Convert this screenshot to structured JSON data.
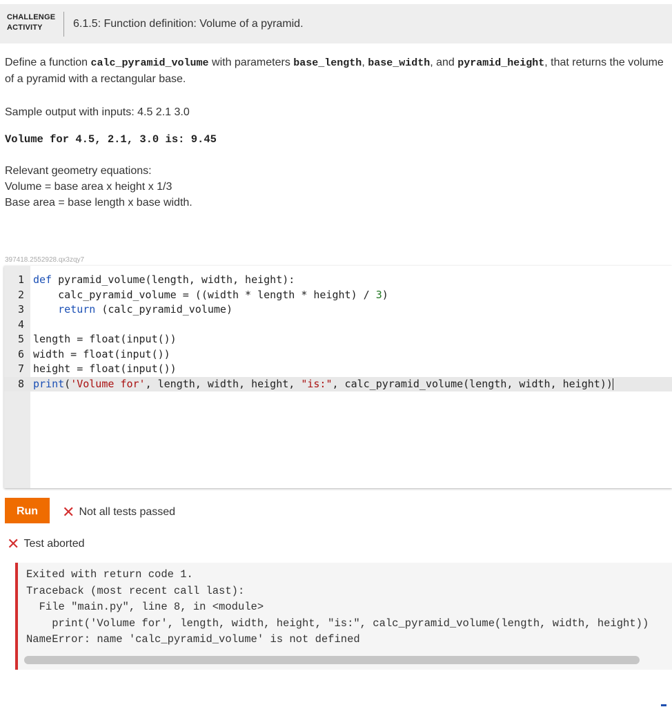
{
  "header": {
    "tag_line1": "CHALLENGE",
    "tag_line2": "ACTIVITY",
    "title": "6.1.5: Function definition: Volume of a pyramid."
  },
  "prompt": {
    "p1_a": "Define a function ",
    "p1_fn": "calc_pyramid_volume",
    "p1_b": " with parameters ",
    "p1_param1": "base_length",
    "p1_c": ", ",
    "p1_param2": "base_width",
    "p1_d": ", and ",
    "p1_param3": "pyramid_height",
    "p1_e": ", that returns the volume of a pyramid with a rectangular base.",
    "sample_label": "Sample output with inputs: 4.5 2.1 3.0",
    "sample_output": "Volume for 4.5, 2.1, 3.0 is: 9.45",
    "geometry_title": "Relevant geometry equations:",
    "geometry_line1": "Volume = base area x height x 1/3",
    "geometry_line2": "Base area = base length x base width."
  },
  "challenge_id": "397418.2552928.qx3zqy7",
  "editor": {
    "line_numbers": [
      "1",
      "2",
      "3",
      "4",
      "5",
      "6",
      "7",
      "8"
    ],
    "active_line": 8
  },
  "run_button": {
    "label": "Run"
  },
  "status": {
    "icon": "x-icon",
    "text": "Not all tests passed"
  },
  "test_result": {
    "icon": "x-icon",
    "text": "Test aborted"
  },
  "output": {
    "lines": [
      "Exited with return code 1.",
      "Traceback (most recent call last):",
      "  File \"main.py\", line 8, in <module>",
      "    print('Volume for', length, width, height, \"is:\", calc_pyramid_volume(length, width, height))",
      "NameError: name 'calc_pyramid_volume' is not defined"
    ]
  },
  "colors": {
    "run_button": "#ef6c00",
    "error": "#d32f2f",
    "keyword": "#1a4fb5",
    "string": "#a11111",
    "number": "#227722"
  }
}
